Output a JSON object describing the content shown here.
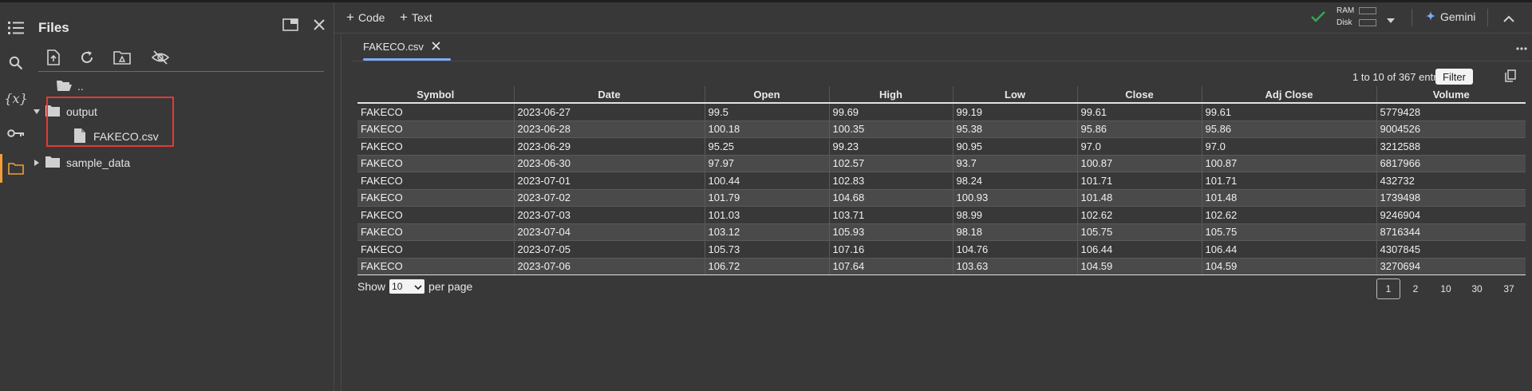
{
  "rail": {
    "icons": [
      "list-icon",
      "search-icon",
      "variables-icon",
      "key-icon",
      "folder-icon"
    ],
    "variables_glyph": "{x}"
  },
  "files_panel": {
    "title": "Files",
    "parent_dir": "..",
    "tree": {
      "output": "output",
      "output_child": "FAKECO.csv",
      "sample_data": "sample_data"
    }
  },
  "topbar": {
    "add_code": "Code",
    "add_text": "Text",
    "ram": "RAM",
    "disk": "Disk",
    "gemini": "Gemini"
  },
  "tab": {
    "label": "FAKECO.csv"
  },
  "table": {
    "entries_info": "1 to 10 of 367 entries",
    "filter_label": "Filter",
    "columns": [
      "Symbol",
      "Date",
      "Open",
      "High",
      "Low",
      "Close",
      "Adj Close",
      "Volume"
    ],
    "rows": [
      [
        "FAKECO",
        "2023-06-27",
        "99.5",
        "99.69",
        "99.19",
        "99.61",
        "99.61",
        "5779428"
      ],
      [
        "FAKECO",
        "2023-06-28",
        "100.18",
        "100.35",
        "95.38",
        "95.86",
        "95.86",
        "9004526"
      ],
      [
        "FAKECO",
        "2023-06-29",
        "95.25",
        "99.23",
        "90.95",
        "97.0",
        "97.0",
        "3212588"
      ],
      [
        "FAKECO",
        "2023-06-30",
        "97.97",
        "102.57",
        "93.7",
        "100.87",
        "100.87",
        "6817966"
      ],
      [
        "FAKECO",
        "2023-07-01",
        "100.44",
        "102.83",
        "98.24",
        "101.71",
        "101.71",
        "432732"
      ],
      [
        "FAKECO",
        "2023-07-02",
        "101.79",
        "104.68",
        "100.93",
        "101.48",
        "101.48",
        "1739498"
      ],
      [
        "FAKECO",
        "2023-07-03",
        "101.03",
        "103.71",
        "98.99",
        "102.62",
        "102.62",
        "9246904"
      ],
      [
        "FAKECO",
        "2023-07-04",
        "103.12",
        "105.93",
        "98.18",
        "105.75",
        "105.75",
        "8716344"
      ],
      [
        "FAKECO",
        "2023-07-05",
        "105.73",
        "107.16",
        "104.76",
        "106.44",
        "106.44",
        "4307845"
      ],
      [
        "FAKECO",
        "2023-07-06",
        "106.72",
        "107.64",
        "103.63",
        "104.59",
        "104.59",
        "3270694"
      ]
    ],
    "show_label": "Show",
    "per_page_value": "10",
    "per_page_label": "per page",
    "pages": [
      "1",
      "2",
      "10",
      "30",
      "37"
    ],
    "active_page": "1"
  },
  "colors": {
    "accent_blue": "#7cacf8",
    "active_orange": "#f29d38",
    "check_green": "#34a853",
    "highlight_red": "#e53935"
  }
}
